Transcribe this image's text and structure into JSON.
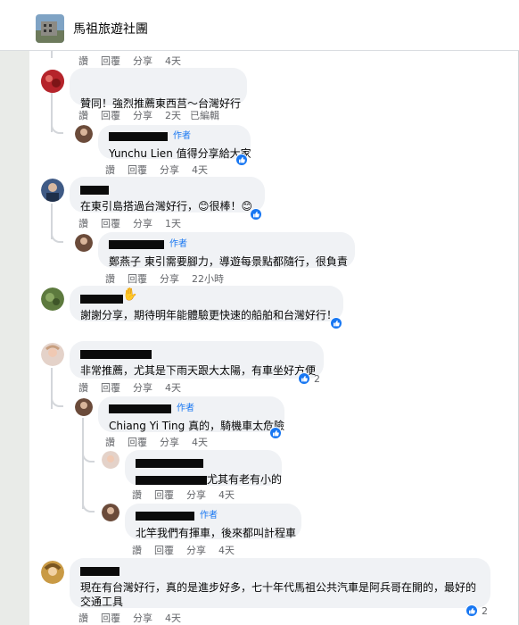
{
  "group": {
    "name": "馬祖旅遊社團"
  },
  "colors": {
    "accent": "#1877f2",
    "bubble": "#f0f2f5",
    "meta": "#65676b"
  },
  "top_actions": {
    "like": "讚",
    "reply": "回覆",
    "share": "分享",
    "time": "4天"
  },
  "comments": [
    {
      "id": "c1",
      "text": "贊同！強烈推薦東西莒～台灣好行",
      "actions": {
        "like": "讚",
        "reply": "回覆",
        "share": "分享",
        "time": "2天",
        "edited": "已編輯"
      }
    },
    {
      "id": "r1",
      "author_badge": "作者",
      "text": "Yunchu Lien 值得分享給大家",
      "actions": {
        "like": "讚",
        "reply": "回覆",
        "share": "分享",
        "time": "4天"
      }
    },
    {
      "id": "c2",
      "text": "在東引島搭過台灣好行，😊很棒！😊",
      "actions": {
        "like": "讚",
        "reply": "回覆",
        "share": "分享",
        "time": "1天"
      }
    },
    {
      "id": "r2",
      "author_badge": "作者",
      "text": "鄭燕子 東引需要腳力，導遊每景點都隨行，很負責",
      "actions": {
        "like": "讚",
        "reply": "回覆",
        "share": "分享",
        "time": "22小時"
      }
    },
    {
      "id": "c3",
      "text": "謝謝分享，期待明年能體驗更快速的船舶和台灣好行！"
    },
    {
      "id": "c4",
      "text": "非常推薦，尤其是下雨天跟大太陽，有車坐好方便",
      "reactions": "2",
      "actions": {
        "like": "讚",
        "reply": "回覆",
        "share": "分享",
        "time": "4天"
      }
    },
    {
      "id": "r4a",
      "author_badge": "作者",
      "text": "Chiang Yi Ting 真的，騎機車太危險",
      "actions": {
        "like": "讚",
        "reply": "回覆",
        "share": "分享",
        "time": "4天"
      }
    },
    {
      "id": "r4b",
      "text": "尤其有老有小的",
      "actions": {
        "like": "讚",
        "reply": "回覆",
        "share": "分享",
        "time": "4天"
      }
    },
    {
      "id": "r4c",
      "author_badge": "作者",
      "text": "北竿我們有揮車，後來都叫計程車",
      "actions": {
        "like": "讚",
        "reply": "回覆",
        "share": "分享",
        "time": "4天"
      }
    },
    {
      "id": "c5",
      "text_line1": "現在有台灣好行，真的是進步好多，七十年代馬祖公共汽車是阿兵哥在開的，最好的",
      "text_line2": "交通工具",
      "reactions": "2",
      "actions": {
        "like": "讚",
        "reply": "回覆",
        "share": "分享",
        "time": "4天"
      }
    }
  ]
}
